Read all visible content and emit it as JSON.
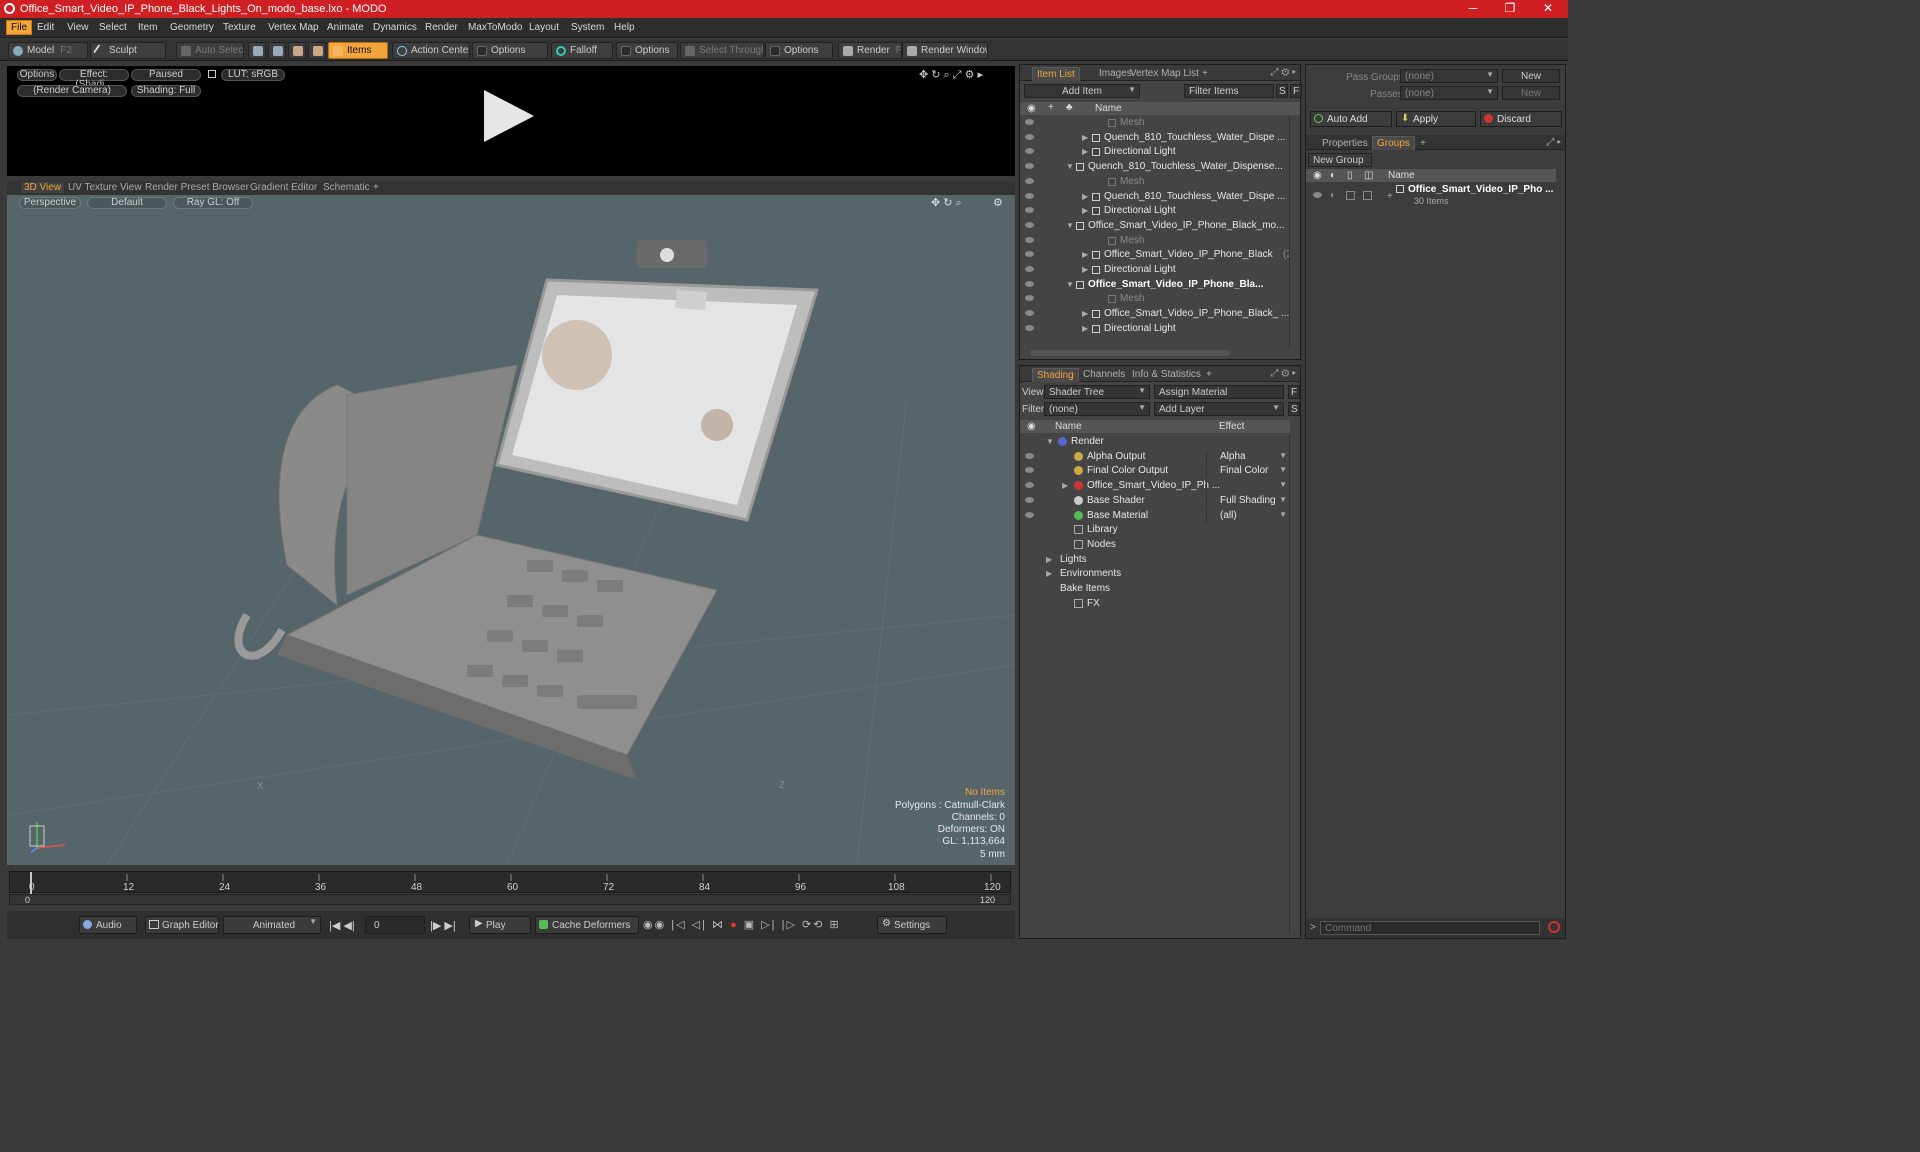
{
  "window": {
    "title": "Office_Smart_Video_IP_Phone_Black_Lights_On_modo_base.lxo - MODO",
    "minimize": "─",
    "maximize": "❐",
    "close": "✕"
  },
  "menu": [
    "File",
    "Edit",
    "View",
    "Select",
    "Item",
    "Geometry",
    "Texture",
    "Vertex Map",
    "Animate",
    "Dynamics",
    "Render",
    "MaxToModo",
    "Layout",
    "System",
    "Help"
  ],
  "toolbar": {
    "model": "Model",
    "model_key": "F2",
    "sculpt": "Sculpt",
    "auto_select": "Auto Select",
    "items": "Items",
    "action_center": "Action Center",
    "options1": "Options",
    "falloff": "Falloff",
    "options2": "Options",
    "select_through": "Select Through",
    "options3": "Options",
    "render": "Render",
    "render_key": "F9",
    "render_window": "Render Window"
  },
  "preview": {
    "options": "Options",
    "effect": "Effect: (Shadi...",
    "paused": "Paused",
    "lut": "LUT: sRGB",
    "camera": "(Render Camera)",
    "shading": "Shading: Full"
  },
  "viewport": {
    "tabs": [
      "3D View",
      "UV Texture View",
      "Render Preset Browser",
      "Gradient Editor",
      "Schematic",
      "+"
    ],
    "perspective": "Perspective",
    "default": "Default",
    "raygl": "Ray GL: Off",
    "info": {
      "items": "No Items",
      "polygons": "Polygons : Catmull-Clark",
      "channels": "Channels: 0",
      "deformers": "Deformers: ON",
      "gl": "GL: 1,113,664",
      "scale": "5 mm"
    },
    "axis_x": "X",
    "axis_z": "Z"
  },
  "timeline": {
    "ticks": [
      "0",
      "12",
      "24",
      "36",
      "48",
      "60",
      "72",
      "84",
      "96",
      "108",
      "120"
    ],
    "start": "0",
    "end": "120",
    "end2": "120"
  },
  "bottombar": {
    "audio": "Audio",
    "graph_editor": "Graph Editor",
    "animated": "Animated",
    "frame": "0",
    "play": "Play",
    "cache": "Cache Deformers",
    "settings": "Settings"
  },
  "itemlist": {
    "tabs": [
      "Item List",
      "Images",
      "Vertex Map List",
      "+"
    ],
    "add_item": "Add Item",
    "filter_items": "Filter Items",
    "s": "S",
    "f": "F",
    "col_name": "Name",
    "rows": [
      {
        "label": "Mesh",
        "depth": 3,
        "dim": true
      },
      {
        "label": "Quench_810_Touchless_Water_Dispe ...",
        "depth": 2
      },
      {
        "label": "Directional Light",
        "depth": 2
      },
      {
        "label": "Quench_810_Touchless_Water_Dispense...",
        "depth": 1
      },
      {
        "label": "Mesh",
        "depth": 3,
        "dim": true
      },
      {
        "label": "Quench_810_Touchless_Water_Dispe ...",
        "depth": 2
      },
      {
        "label": "Directional Light",
        "depth": 2
      },
      {
        "label": "Office_Smart_Video_IP_Phone_Black_mo...",
        "depth": 1
      },
      {
        "label": "Mesh",
        "depth": 3,
        "dim": true
      },
      {
        "label": "Office_Smart_Video_IP_Phone_Black",
        "count": "(2)",
        "depth": 2
      },
      {
        "label": "Directional Light",
        "depth": 2
      },
      {
        "label": "Office_Smart_Video_IP_Phone_Bla...",
        "depth": 1,
        "bold": true
      },
      {
        "label": "Mesh",
        "depth": 3,
        "dim": true
      },
      {
        "label": "Office_Smart_Video_IP_Phone_Black_ ...",
        "depth": 2
      },
      {
        "label": "Directional Light",
        "depth": 2
      }
    ]
  },
  "shading": {
    "tabs": [
      "Shading",
      "Channels",
      "Info & Statistics",
      "+"
    ],
    "view_label": "View",
    "view_value": "Shader Tree",
    "assign": "Assign Material",
    "f": "F",
    "filter_label": "Filter",
    "filter_value": "(none)",
    "add_layer": "Add Layer",
    "s": "S",
    "col_name": "Name",
    "col_effect": "Effect",
    "rows": [
      {
        "label": "Render",
        "effect": "",
        "depth": 0
      },
      {
        "label": "Alpha Output",
        "effect": "Alpha",
        "depth": 1
      },
      {
        "label": "Final Color Output",
        "effect": "Final Color",
        "depth": 1
      },
      {
        "label": "Office_Smart_Video_IP_Ph ...",
        "effect": "",
        "depth": 1
      },
      {
        "label": "Base Shader",
        "effect": "Full Shading",
        "depth": 1
      },
      {
        "label": "Base Material",
        "effect": "(all)",
        "depth": 1
      },
      {
        "label": "Library",
        "effect": "",
        "depth": 1
      },
      {
        "label": "Nodes",
        "effect": "",
        "depth": 1
      },
      {
        "label": "Lights",
        "effect": "",
        "depth": 0
      },
      {
        "label": "Environments",
        "effect": "",
        "depth": 0
      },
      {
        "label": "Bake Items",
        "effect": "",
        "depth": 0
      },
      {
        "label": "FX",
        "effect": "",
        "depth": 1
      }
    ]
  },
  "groups": {
    "pass_groups": "Pass Groups",
    "pass_value": "(none)",
    "new": "New",
    "passes": "Passes",
    "passes_value": "(none)",
    "new2": "New",
    "auto_add": "Auto Add",
    "apply": "Apply",
    "discard": "Discard",
    "tabs": [
      "Properties",
      "Groups",
      "+"
    ],
    "new_group": "New Group",
    "col_name": "Name",
    "item": "Office_Smart_Video_IP_Pho ...",
    "item_sub": "30 Items"
  },
  "command": {
    "placeholder": "Command",
    "prompt": ">"
  },
  "colors": {
    "accent": "#f3a43a",
    "title_red": "#d01f22",
    "viewport": "#56656a"
  }
}
